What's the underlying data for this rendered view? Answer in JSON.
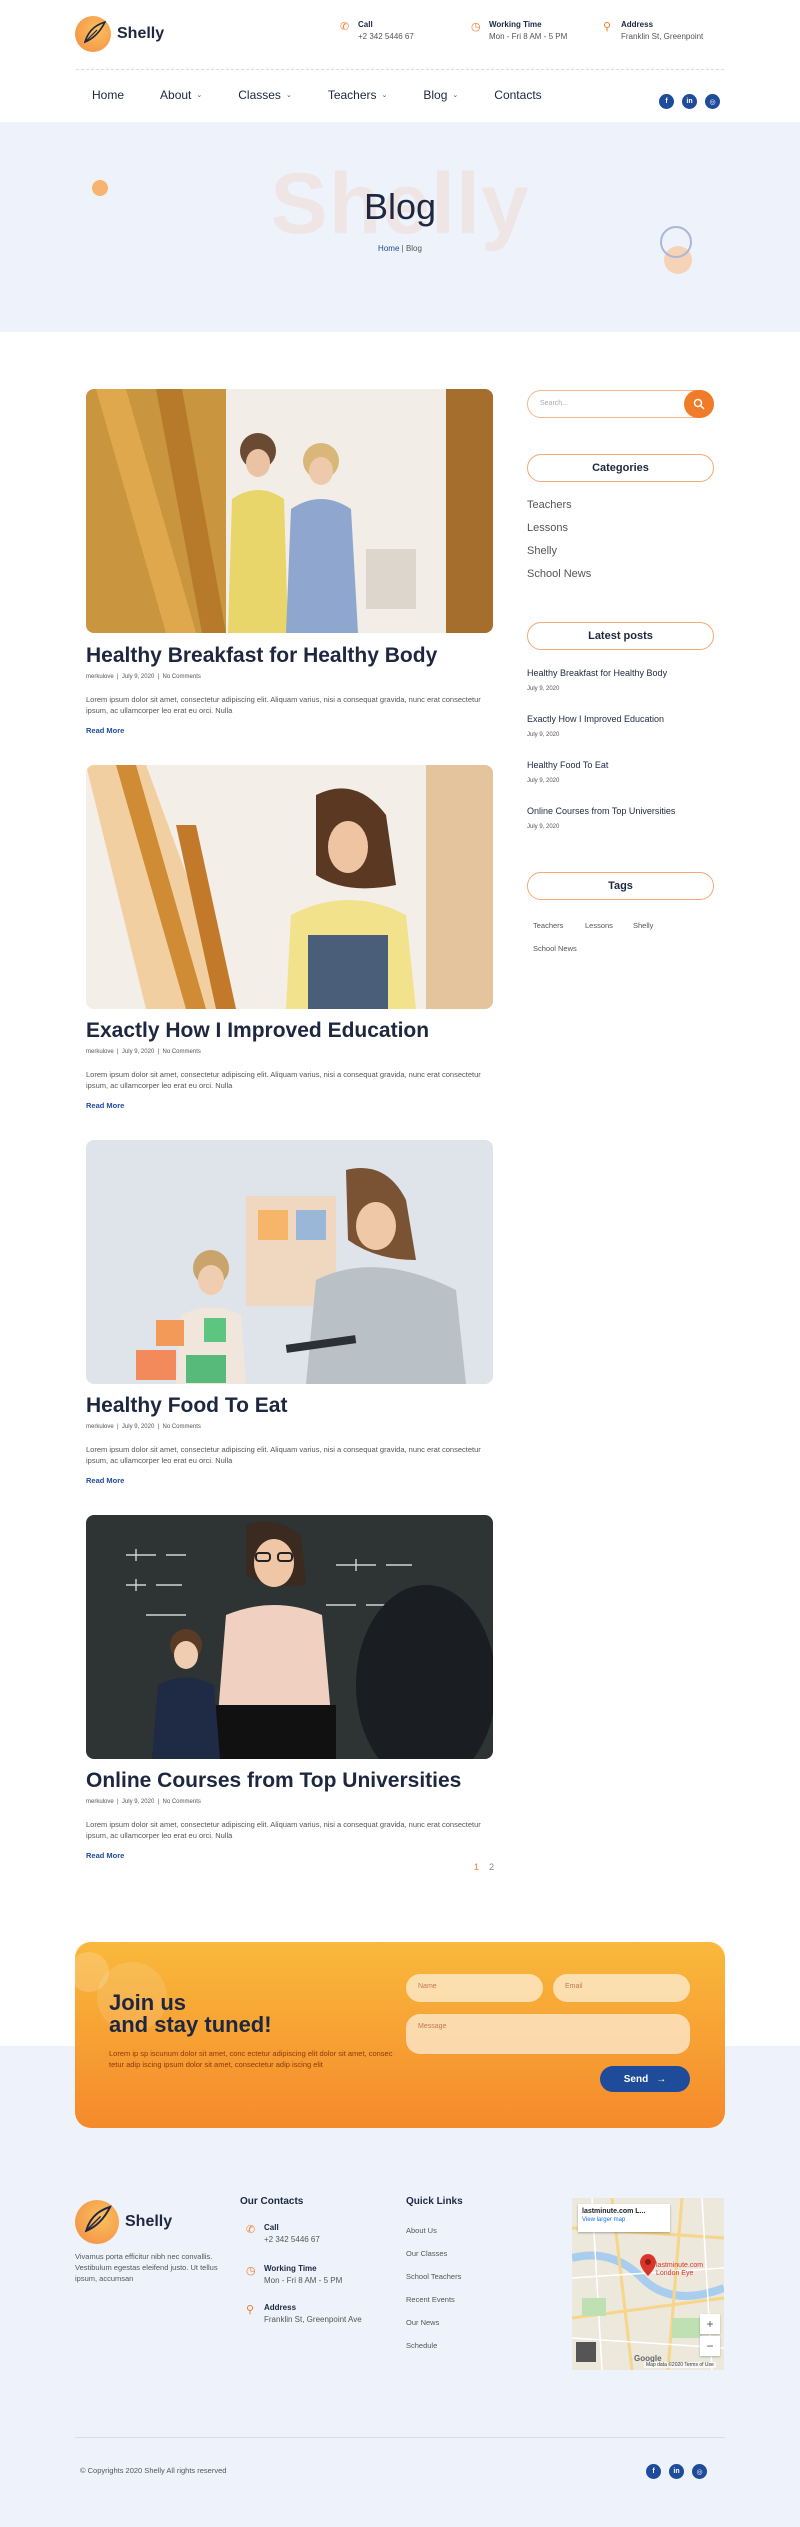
{
  "brand": {
    "name": "Shelly"
  },
  "header": {
    "call": {
      "title": "Call",
      "value": "+2 342 5446 67"
    },
    "hours": {
      "title": "Working Time",
      "value": "Mon - Fri 8 AM - 5 PM"
    },
    "address": {
      "title": "Address",
      "value": "Franklin St, Greenpoint"
    }
  },
  "nav": {
    "items": [
      {
        "label": "Home",
        "has_dropdown": false
      },
      {
        "label": "About",
        "has_dropdown": true
      },
      {
        "label": "Classes",
        "has_dropdown": true
      },
      {
        "label": "Teachers",
        "has_dropdown": true
      },
      {
        "label": "Blog",
        "has_dropdown": true
      },
      {
        "label": "Contacts",
        "has_dropdown": false
      }
    ],
    "socials": [
      "f",
      "in",
      "ig"
    ]
  },
  "hero": {
    "ghost_text": "Shelly",
    "title": "Blog",
    "breadcrumb": {
      "home": "Home",
      "sep": "|",
      "current": "Blog"
    }
  },
  "posts": [
    {
      "title": "Healthy Breakfast for Healthy Body",
      "author": "merkulove",
      "date": "July 9, 2020",
      "comments": "No Comments",
      "excerpt": "Lorem ipsum dolor sit amet, consectetur adipiscing elit. Aliquam varius, nisi a consequat gravida, nunc erat consectetur ipsum, ac ullamcorper leo erat eu orci. Nulla",
      "read_more": "Read More"
    },
    {
      "title": "Exactly How I Improved Education",
      "author": "merkulove",
      "date": "July 9, 2020",
      "comments": "No Comments",
      "excerpt": "Lorem ipsum dolor sit amet, consectetur adipiscing elit. Aliquam varius, nisi a consequat gravida, nunc erat consectetur ipsum, ac ullamcorper leo erat eu orci. Nulla",
      "read_more": "Read More"
    },
    {
      "title": "Healthy Food To Eat",
      "author": "merkulove",
      "date": "July 9, 2020",
      "comments": "No Comments",
      "excerpt": "Lorem ipsum dolor sit amet, consectetur adipiscing elit. Aliquam varius, nisi a consequat gravida, nunc erat consectetur ipsum, ac ullamcorper leo erat eu orci. Nulla",
      "read_more": "Read More"
    },
    {
      "title": "Online Courses from Top Universities",
      "author": "merkulove",
      "date": "July 9, 2020",
      "comments": "No Comments",
      "excerpt": "Lorem ipsum dolor sit amet, consectetur adipiscing elit. Aliquam varius, nisi a consequat gravida, nunc erat consectetur ipsum, ac ullamcorper leo erat eu orci. Nulla",
      "read_more": "Read More"
    }
  ],
  "pagination": {
    "current": "1",
    "next": "2"
  },
  "sidebar": {
    "search_placeholder": "Search...",
    "categories_title": "Categories",
    "categories": [
      "Teachers",
      "Lessons",
      "Shelly",
      "School News"
    ],
    "latest_title": "Latest posts",
    "latest": [
      {
        "title": "Healthy Breakfast for Healthy Body",
        "date": "July 9, 2020"
      },
      {
        "title": "Exactly How I Improved Education",
        "date": "July 9, 2020"
      },
      {
        "title": "Healthy Food To Eat",
        "date": "July 9, 2020"
      },
      {
        "title": "Online Courses from Top Universities",
        "date": "July 9, 2020"
      }
    ],
    "tags_title": "Tags",
    "tags": [
      "Teachers",
      "Lessons",
      "Shelly",
      "School News"
    ]
  },
  "cta": {
    "title_line1": "Join us",
    "title_line2": "and stay tuned!",
    "text": "Lorem ip sp iscunum dolor sit amet, conc ectetur adipiscing elit dolor sit amet, consec tetur adip iscing ipsum dolor sit amet, consectetur adip iscing elit",
    "name_placeholder": "Name",
    "email_placeholder": "Email",
    "message_placeholder": "Message",
    "send_label": "Send"
  },
  "footer": {
    "description": "Vivamus porta efficitur nibh nec convallis. Vestibulum egestas eleifend justo. Ut tellus ipsum, accumsan",
    "contacts_title": "Our Contacts",
    "call": {
      "title": "Call",
      "value": "+2 342 5446 67"
    },
    "hours": {
      "title": "Working Time",
      "value": "Mon - Fri 8 AM - 5 PM"
    },
    "address": {
      "title": "Address",
      "value": "Franklin St, Greenpoint Ave"
    },
    "links_title": "Quick Links",
    "links": [
      "About Us",
      "Our Classes",
      "School Teachers",
      "Recent Events",
      "Our News",
      "Schedule"
    ],
    "map": {
      "place": "lastminute.com L...",
      "link": "View larger map",
      "pin_label": "lastminute.com London Eye",
      "google": "Google",
      "foot": "Map data ©2020   Terms of Use"
    },
    "copyright": "© Copyrights 2020 Shelly All rights reserved"
  },
  "colors": {
    "accent": "#f07c2a",
    "navy": "#1e2740",
    "blue": "#1e4b9a",
    "hero_bg": "#eef3fb"
  }
}
